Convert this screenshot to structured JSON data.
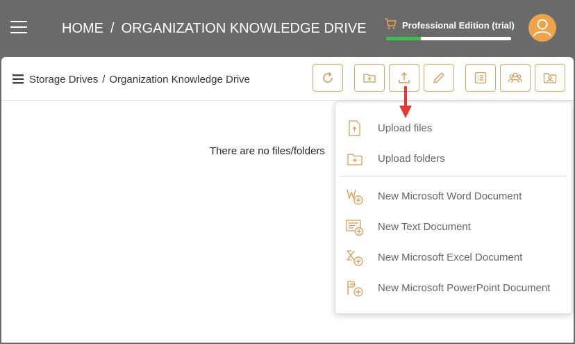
{
  "header": {
    "home": "HOME",
    "separator": "/",
    "drive": "ORGANIZATION KNOWLEDGE DRIVE",
    "edition": "Professional Edition (trial)",
    "trial_progress": 0.28,
    "icons": [
      "menu-icon",
      "cart-icon",
      "user-icon"
    ]
  },
  "breadcrumb": {
    "items": [
      "Storage Drives",
      "Organization Knowledge Drive"
    ],
    "separator": "/"
  },
  "toolbar": {
    "buttons": [
      "refresh-icon",
      "new-folder-icon",
      "upload-icon",
      "edit-icon",
      "details-icon",
      "users-icon",
      "contact-icon"
    ]
  },
  "main": {
    "empty_message": "There are no files/folders"
  },
  "upload_menu": {
    "items": [
      {
        "label": "Upload files",
        "icon": "file-upload-icon"
      },
      {
        "label": "Upload folders",
        "icon": "folder-plus-icon"
      },
      {
        "label": "New Microsoft Word Document",
        "icon": "word-add-icon"
      },
      {
        "label": "New Text Document",
        "icon": "text-add-icon"
      },
      {
        "label": "New Microsoft Excel Document",
        "icon": "excel-add-icon"
      },
      {
        "label": "New Microsoft PowerPoint Document",
        "icon": "powerpoint-add-icon"
      }
    ]
  },
  "colors": {
    "accent": "#d9954a",
    "header_bg": "#6a6a6a",
    "progress": "#3cbf4b",
    "avatar": "#f0a24a",
    "arrow": "#e53935"
  }
}
